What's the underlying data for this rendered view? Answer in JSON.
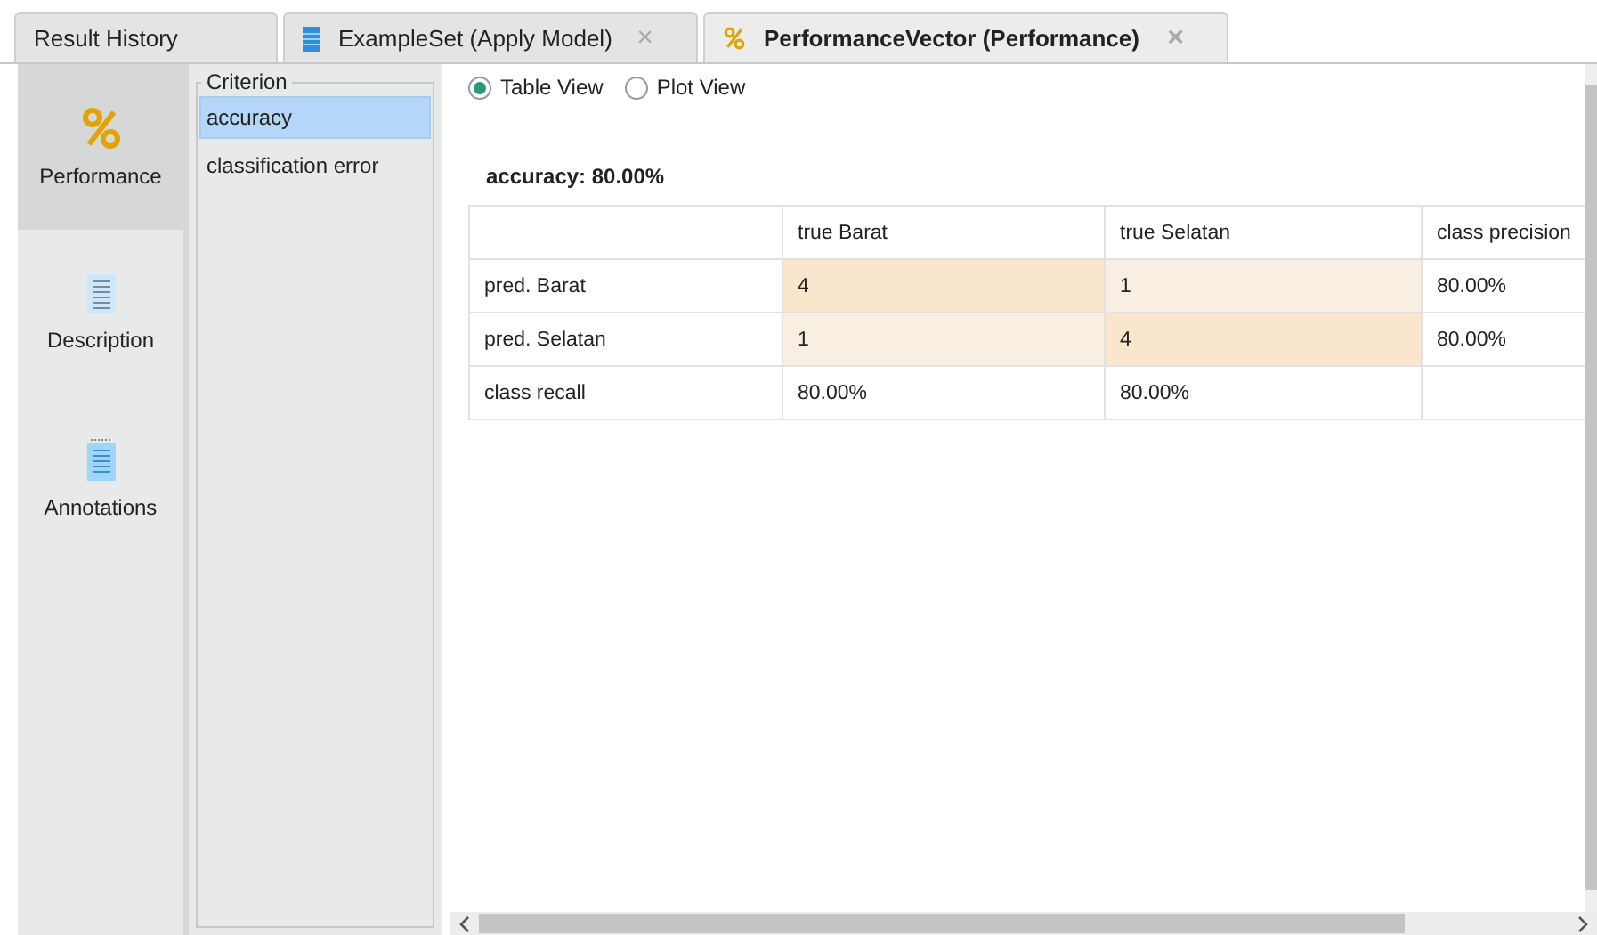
{
  "tabs": [
    {
      "label": "Result History",
      "closable": false,
      "selected": false
    },
    {
      "label": "ExampleSet (Apply Model)",
      "closable": true,
      "selected": false
    },
    {
      "label": "PerformanceVector (Performance)",
      "closable": true,
      "selected": true
    }
  ],
  "close_glyph": "×",
  "sidebar": {
    "items": [
      {
        "label": "Performance",
        "selected": true
      },
      {
        "label": "Description",
        "selected": false
      },
      {
        "label": "Annotations",
        "selected": false
      }
    ]
  },
  "criterion": {
    "title": "Criterion",
    "items": [
      {
        "label": "accuracy",
        "selected": true
      },
      {
        "label": "classification error",
        "selected": false
      }
    ]
  },
  "views": [
    {
      "label": "Table View",
      "selected": true
    },
    {
      "label": "Plot View",
      "selected": false
    }
  ],
  "result_title": "accuracy: 80.00%",
  "table": {
    "columns": [
      "",
      "true Barat",
      "true Selatan",
      "class precision"
    ],
    "rows": [
      {
        "cells": [
          {
            "text": "pred. Barat"
          },
          {
            "text": "4",
            "color": "#f9e6cd"
          },
          {
            "text": "1",
            "color": "#f8efe2"
          },
          {
            "text": "80.00%"
          }
        ]
      },
      {
        "cells": [
          {
            "text": "pred. Selatan"
          },
          {
            "text": "1",
            "color": "#f8efe2"
          },
          {
            "text": "4",
            "color": "#f9e6cd"
          },
          {
            "text": "80.00%"
          }
        ]
      },
      {
        "cells": [
          {
            "text": "class recall"
          },
          {
            "text": "80.00%"
          },
          {
            "text": "80.00%"
          },
          {
            "text": ""
          }
        ]
      }
    ]
  }
}
